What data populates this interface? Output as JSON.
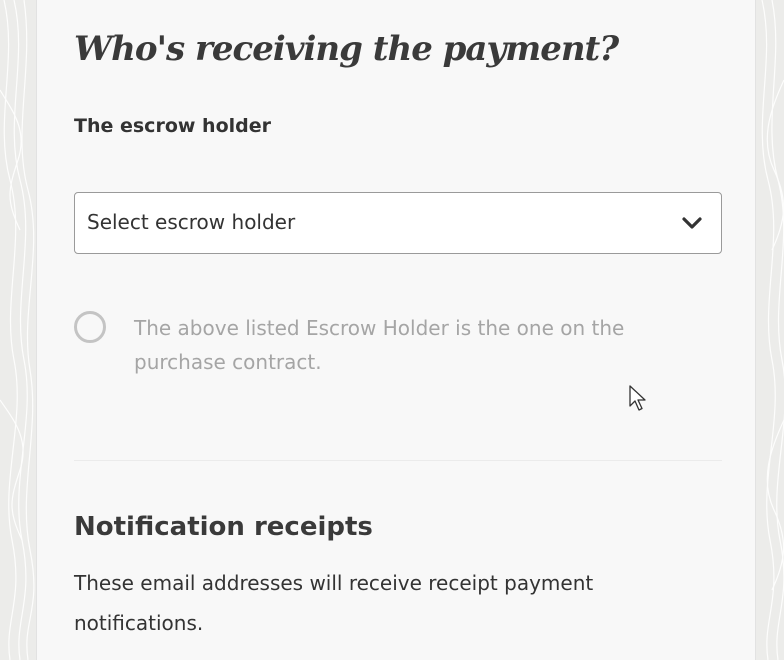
{
  "page": {
    "title": "Who's receiving the payment?"
  },
  "escrow": {
    "label": "The escrow holder",
    "select_value": "Select escrow holder",
    "chevron_icon": "chevron-down-icon",
    "confirm_text": "The above listed Escrow Holder is the one on the purchase contract.",
    "confirm_checked": false
  },
  "notifications": {
    "title": "Notification receipts",
    "description": "These email addresses will receive receipt payment notifications."
  },
  "colors": {
    "background": "#ececea",
    "card": "#f8f8f8",
    "text": "#333333",
    "muted": "#a5a5a5",
    "border": "#9a9a9a"
  }
}
